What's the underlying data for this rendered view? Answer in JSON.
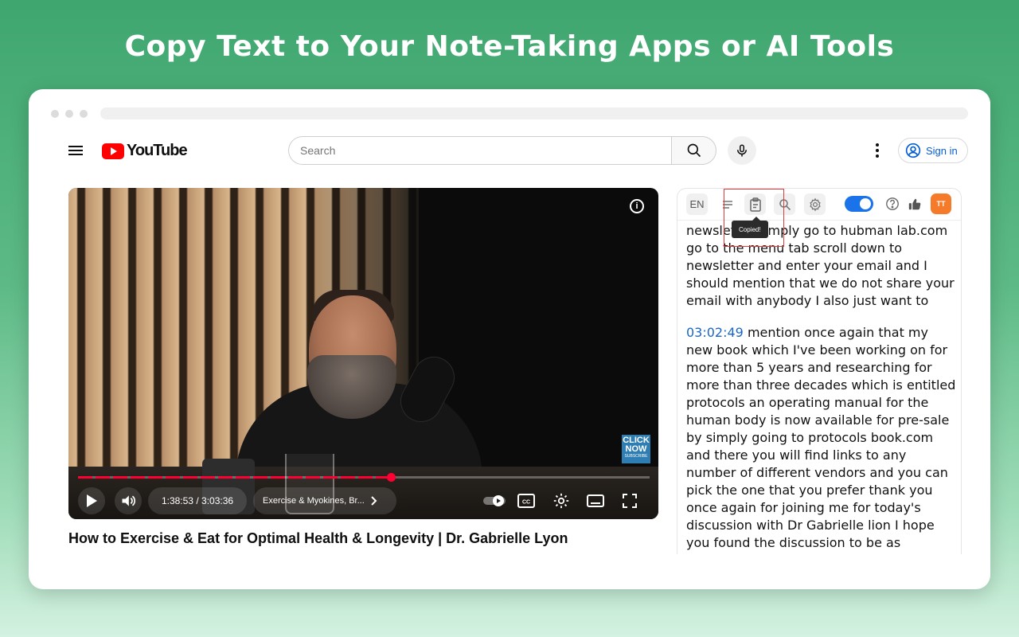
{
  "headline": "Copy Text to Your Note-Taking Apps or AI Tools",
  "youtube": {
    "logo_text": "YouTube",
    "search_placeholder": "Search",
    "signin_label": "Sign in"
  },
  "video": {
    "current_time": "1:38:53",
    "time_separator": "/",
    "duration": "3:03:36",
    "chapter": "Exercise & Myokines, Br...",
    "progress": 0.548,
    "overlay_badge_line1": "CLICK",
    "overlay_badge_line2": "NOW",
    "overlay_badge_line3": "SUBSCRIBE",
    "title": "How to Exercise & Eat for Optimal Health & Longevity | Dr. Gabrielle Lyon"
  },
  "panel": {
    "language": "EN",
    "tooltip": "Copied!",
    "toggle_on": true,
    "brand_badge": "TT",
    "segments": [
      {
        "timestamp": "",
        "text": "newsletter simply go to hubman lab.com go to the menu tab scroll down to newsletter and enter your email and I should mention that we do not share your email with anybody I also just want to"
      },
      {
        "timestamp": "03:02:49",
        "text": " mention once again that my new book which I've been working on for more than 5 years and researching for more than three decades which is entitled protocols an operating manual for the human body is now available for pre-sale by simply going to protocols book.com and there you will find links to any number of different vendors and you can pick the one that you prefer thank you once again for joining me for today's discussion with Dr Gabrielle lion I hope you found the discussion to be as informative and"
      }
    ]
  },
  "colors": {
    "accent_blue": "#1a73e8",
    "youtube_red": "#ff0000",
    "progress_red": "#ff0033",
    "highlight_red": "#e23b3b",
    "timestamp_blue": "#1a66c8"
  }
}
